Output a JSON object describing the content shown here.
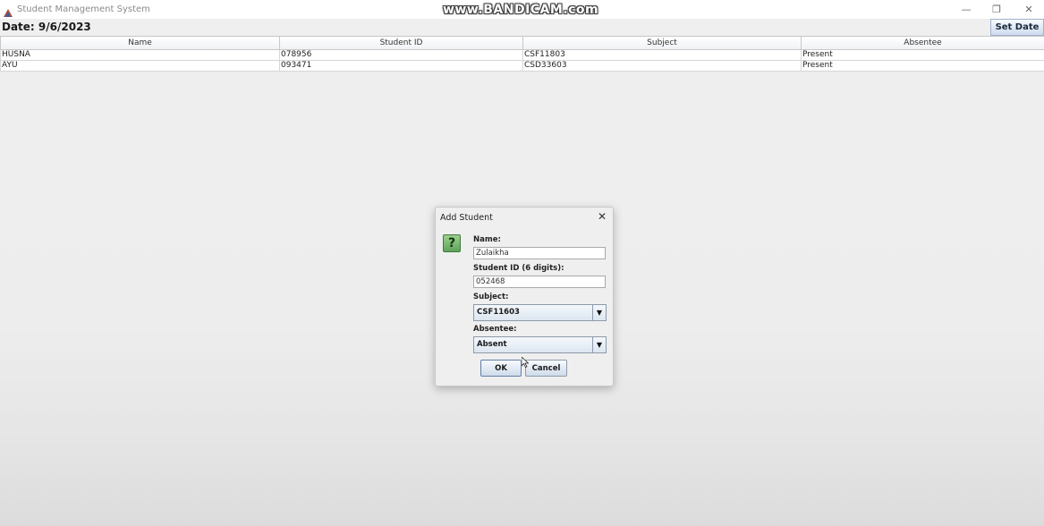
{
  "window": {
    "title": "Student Management System",
    "watermark": "www.BANDICAM.com",
    "controls": {
      "minimize": "—",
      "restore": "❐",
      "close": "✕"
    }
  },
  "header": {
    "date_label": "Date: 9/6/2023",
    "set_date_label": "Set Date"
  },
  "table": {
    "columns": [
      "Name",
      "Student ID",
      "Subject",
      "Absentee"
    ],
    "rows": [
      [
        "HUSNA",
        "078956",
        "CSF11803",
        "Present"
      ],
      [
        "AYU",
        "093471",
        "CSD33603",
        "Present"
      ]
    ]
  },
  "dialog": {
    "title": "Add Student",
    "close_glyph": "✕",
    "icon_glyph": "?",
    "name_label": "Name:",
    "name_value": "Zulaikha",
    "student_id_label": "Student ID (6 digits):",
    "student_id_value": "052468",
    "subject_label": "Subject:",
    "subject_value": "CSF11603",
    "absentee_label": "Absentee:",
    "absentee_value": "Absent",
    "dropdown_glyph": "▼",
    "ok_label": "OK",
    "cancel_label": "Cancel"
  },
  "colors": {
    "button_border": "#8d9aa8",
    "question_icon_green": "#5fa45a"
  }
}
